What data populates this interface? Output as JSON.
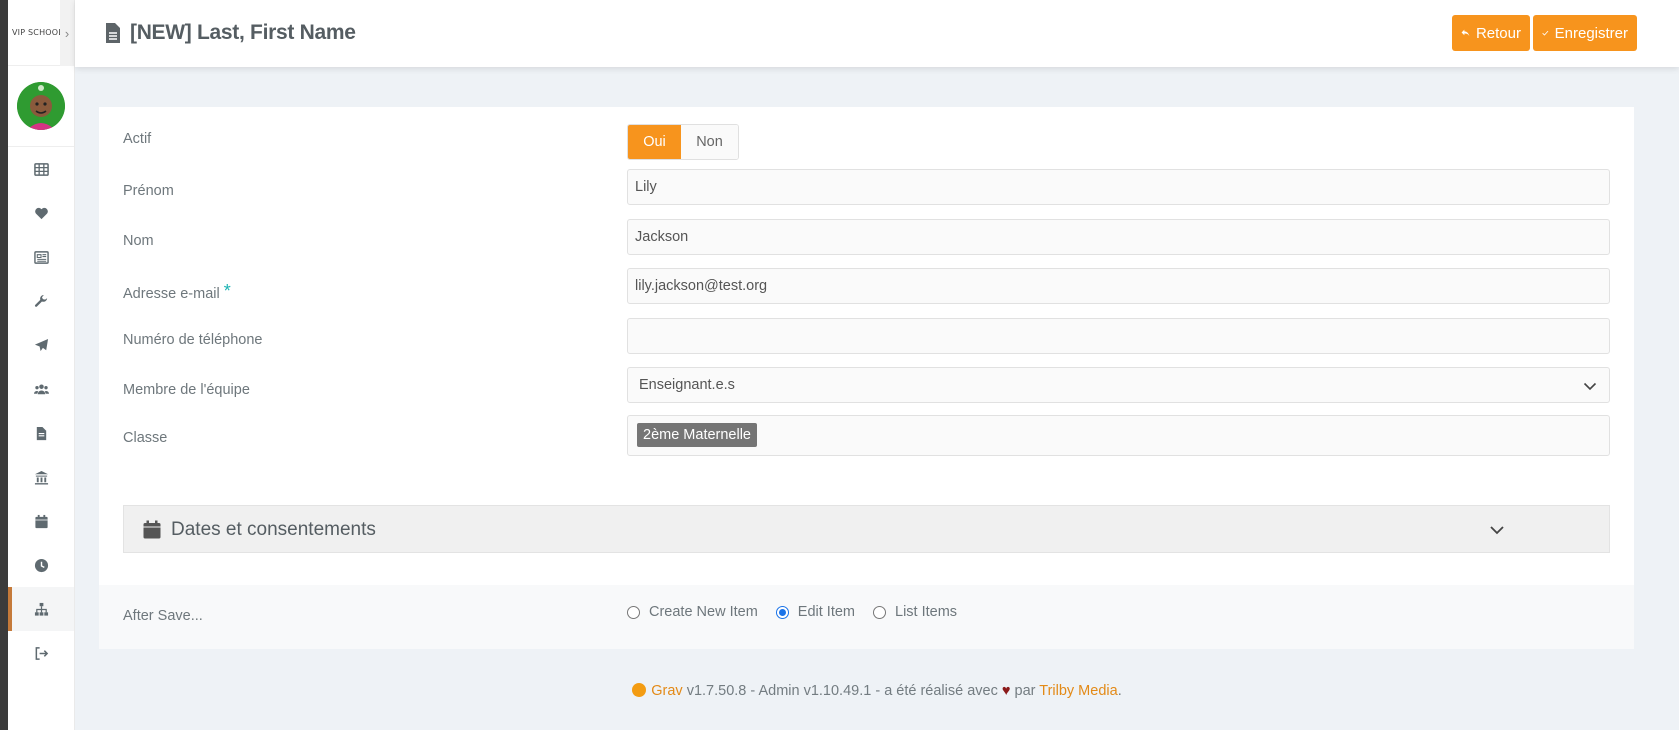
{
  "brand": {
    "logo_text": "VIP SCHOOL"
  },
  "sidebar": {
    "items": [
      {
        "name": "grid-icon"
      },
      {
        "name": "heart-icon"
      },
      {
        "name": "newspaper-icon"
      },
      {
        "name": "wrench-icon"
      },
      {
        "name": "paper-plane-icon"
      },
      {
        "name": "users-icon"
      },
      {
        "name": "file-icon"
      },
      {
        "name": "bank-icon"
      },
      {
        "name": "calendar-icon"
      },
      {
        "name": "clock-icon"
      },
      {
        "name": "sitemap-icon",
        "active": true
      },
      {
        "name": "logout-icon"
      }
    ]
  },
  "header": {
    "title": "[NEW] Last, First Name",
    "back_label": "Retour",
    "save_label": "Enregistrer"
  },
  "form": {
    "actif_label": "Actif",
    "actif_yes": "Oui",
    "actif_no": "Non",
    "prenom_label": "Prénom",
    "prenom_value": "Lily",
    "nom_label": "Nom",
    "nom_value": "Jackson",
    "email_label": "Adresse e-mail",
    "email_required": "*",
    "email_value": "lily.jackson@test.org",
    "phone_label": "Numéro de téléphone",
    "phone_value": "",
    "team_label": "Membre de l'équipe",
    "team_value": "Enseignant.e.s",
    "classe_label": "Classe",
    "classe_tag": "2ème Maternelle",
    "accordion_title": "Dates et consentements"
  },
  "after_save": {
    "label": "After Save...",
    "options": [
      "Create New Item",
      "Edit Item",
      "List Items"
    ],
    "selected": "Edit Item"
  },
  "footer": {
    "grav": "Grav",
    "version_text": " v1.7.50.8 - Admin v1.10.49.1 - a été réalisé avec ",
    "by": " par ",
    "trilby": "Trilby Media",
    "end": "."
  },
  "colors": {
    "accent": "#f7941d",
    "link": "#e38a17",
    "active_bar": "#c57a3a"
  }
}
